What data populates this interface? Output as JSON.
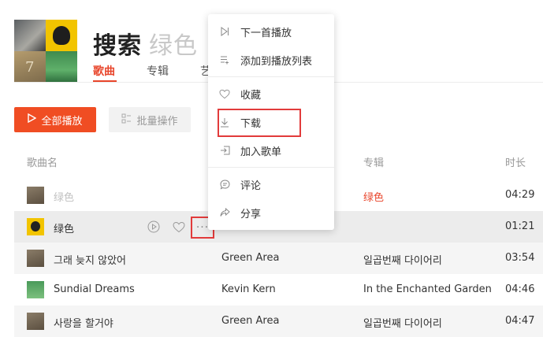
{
  "header": {
    "title": "搜索",
    "query": "绿色",
    "tabs": [
      {
        "label": "歌曲",
        "active": true
      },
      {
        "label": "专辑",
        "active": false
      },
      {
        "label": "艺",
        "active": false
      }
    ]
  },
  "toolbar": {
    "play_all": "全部播放",
    "batch": "批量操作"
  },
  "table": {
    "headers": {
      "song": "歌曲名",
      "album": "专辑",
      "duration": "时长"
    },
    "rows": [
      {
        "title": "绿色",
        "artist": "",
        "album": "绿色",
        "duration": "04:29",
        "thumb": "grey"
      },
      {
        "title": "绿色",
        "artist": "",
        "album": "",
        "duration": "01:21",
        "thumb": "yellow"
      },
      {
        "title": "그래 늦지 않았어",
        "artist": "Green Area",
        "album": "일곱번째 다이어리",
        "duration": "03:54",
        "thumb": "grey"
      },
      {
        "title": "Sundial Dreams",
        "artist": "Kevin Kern",
        "album": "In the Enchanted Garden",
        "duration": "04:46",
        "thumb": "green"
      },
      {
        "title": "사랑을 할거야",
        "artist": "Green Area",
        "album": "일곱번째 다이어리",
        "duration": "04:47",
        "thumb": "grey"
      }
    ],
    "more": "···"
  },
  "menu": {
    "items": [
      {
        "label": "下一首播放",
        "icon": "next-play-icon"
      },
      {
        "label": "添加到播放列表",
        "icon": "add-to-playlist-icon"
      },
      {
        "label": "收藏",
        "icon": "heart-icon"
      },
      {
        "label": "下载",
        "icon": "download-icon"
      },
      {
        "label": "加入歌单",
        "icon": "add-to-songlist-icon"
      },
      {
        "label": "评论",
        "icon": "comment-icon"
      },
      {
        "label": "分享",
        "icon": "share-icon"
      }
    ]
  },
  "colors": {
    "accent": "#f04d23",
    "highlight_box": "#e23b3b"
  }
}
